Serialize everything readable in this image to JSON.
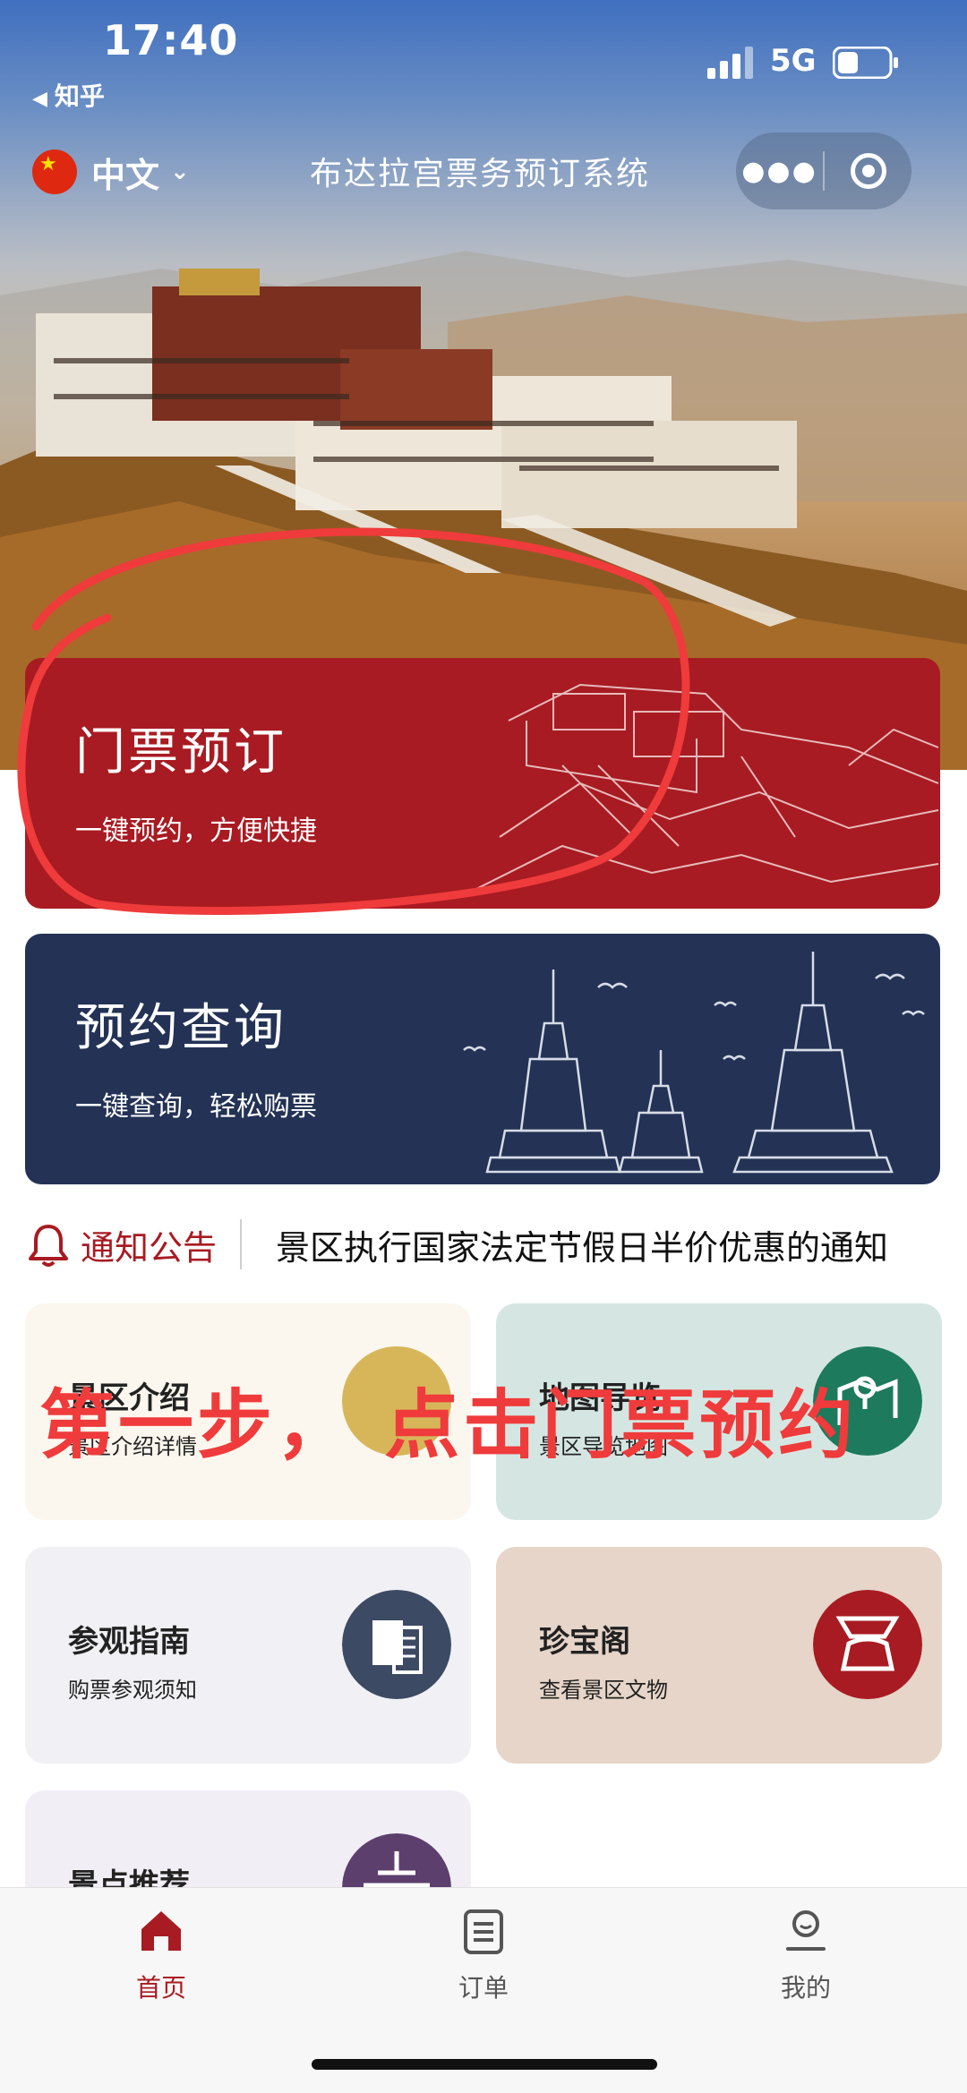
{
  "status_bar": {
    "time": "17:40",
    "back_app": "知乎",
    "network": "5G"
  },
  "nav": {
    "language": "中文",
    "title": "布达拉宫票务预订系统"
  },
  "cards": {
    "ticket": {
      "title": "门票预订",
      "subtitle": "一键预约，方便快捷"
    },
    "query": {
      "title": "预约查询",
      "subtitle": "一键查询，轻松购票"
    }
  },
  "notice": {
    "label": "通知公告",
    "text": "景区执行国家法定节假日半价优惠的通知"
  },
  "grid": [
    {
      "title": "景区介绍",
      "subtitle": "景区介绍详情"
    },
    {
      "title": "地图导览",
      "subtitle": "景区导览地图"
    },
    {
      "title": "参观指南",
      "subtitle": "购票参观须知"
    },
    {
      "title": "珍宝阁",
      "subtitle": "查看景区文物"
    },
    {
      "title": "景点推荐",
      "subtitle": ""
    }
  ],
  "annotation": "第一步，  点击门票预约",
  "tabbar": [
    {
      "label": "首页",
      "icon": "home-icon",
      "active": true
    },
    {
      "label": "订单",
      "icon": "orders-icon",
      "active": false
    },
    {
      "label": "我的",
      "icon": "profile-icon",
      "active": false
    }
  ],
  "colors": {
    "brand_red": "#a81b22",
    "navy": "#233255",
    "annotation_red": "#ef3b3b"
  }
}
